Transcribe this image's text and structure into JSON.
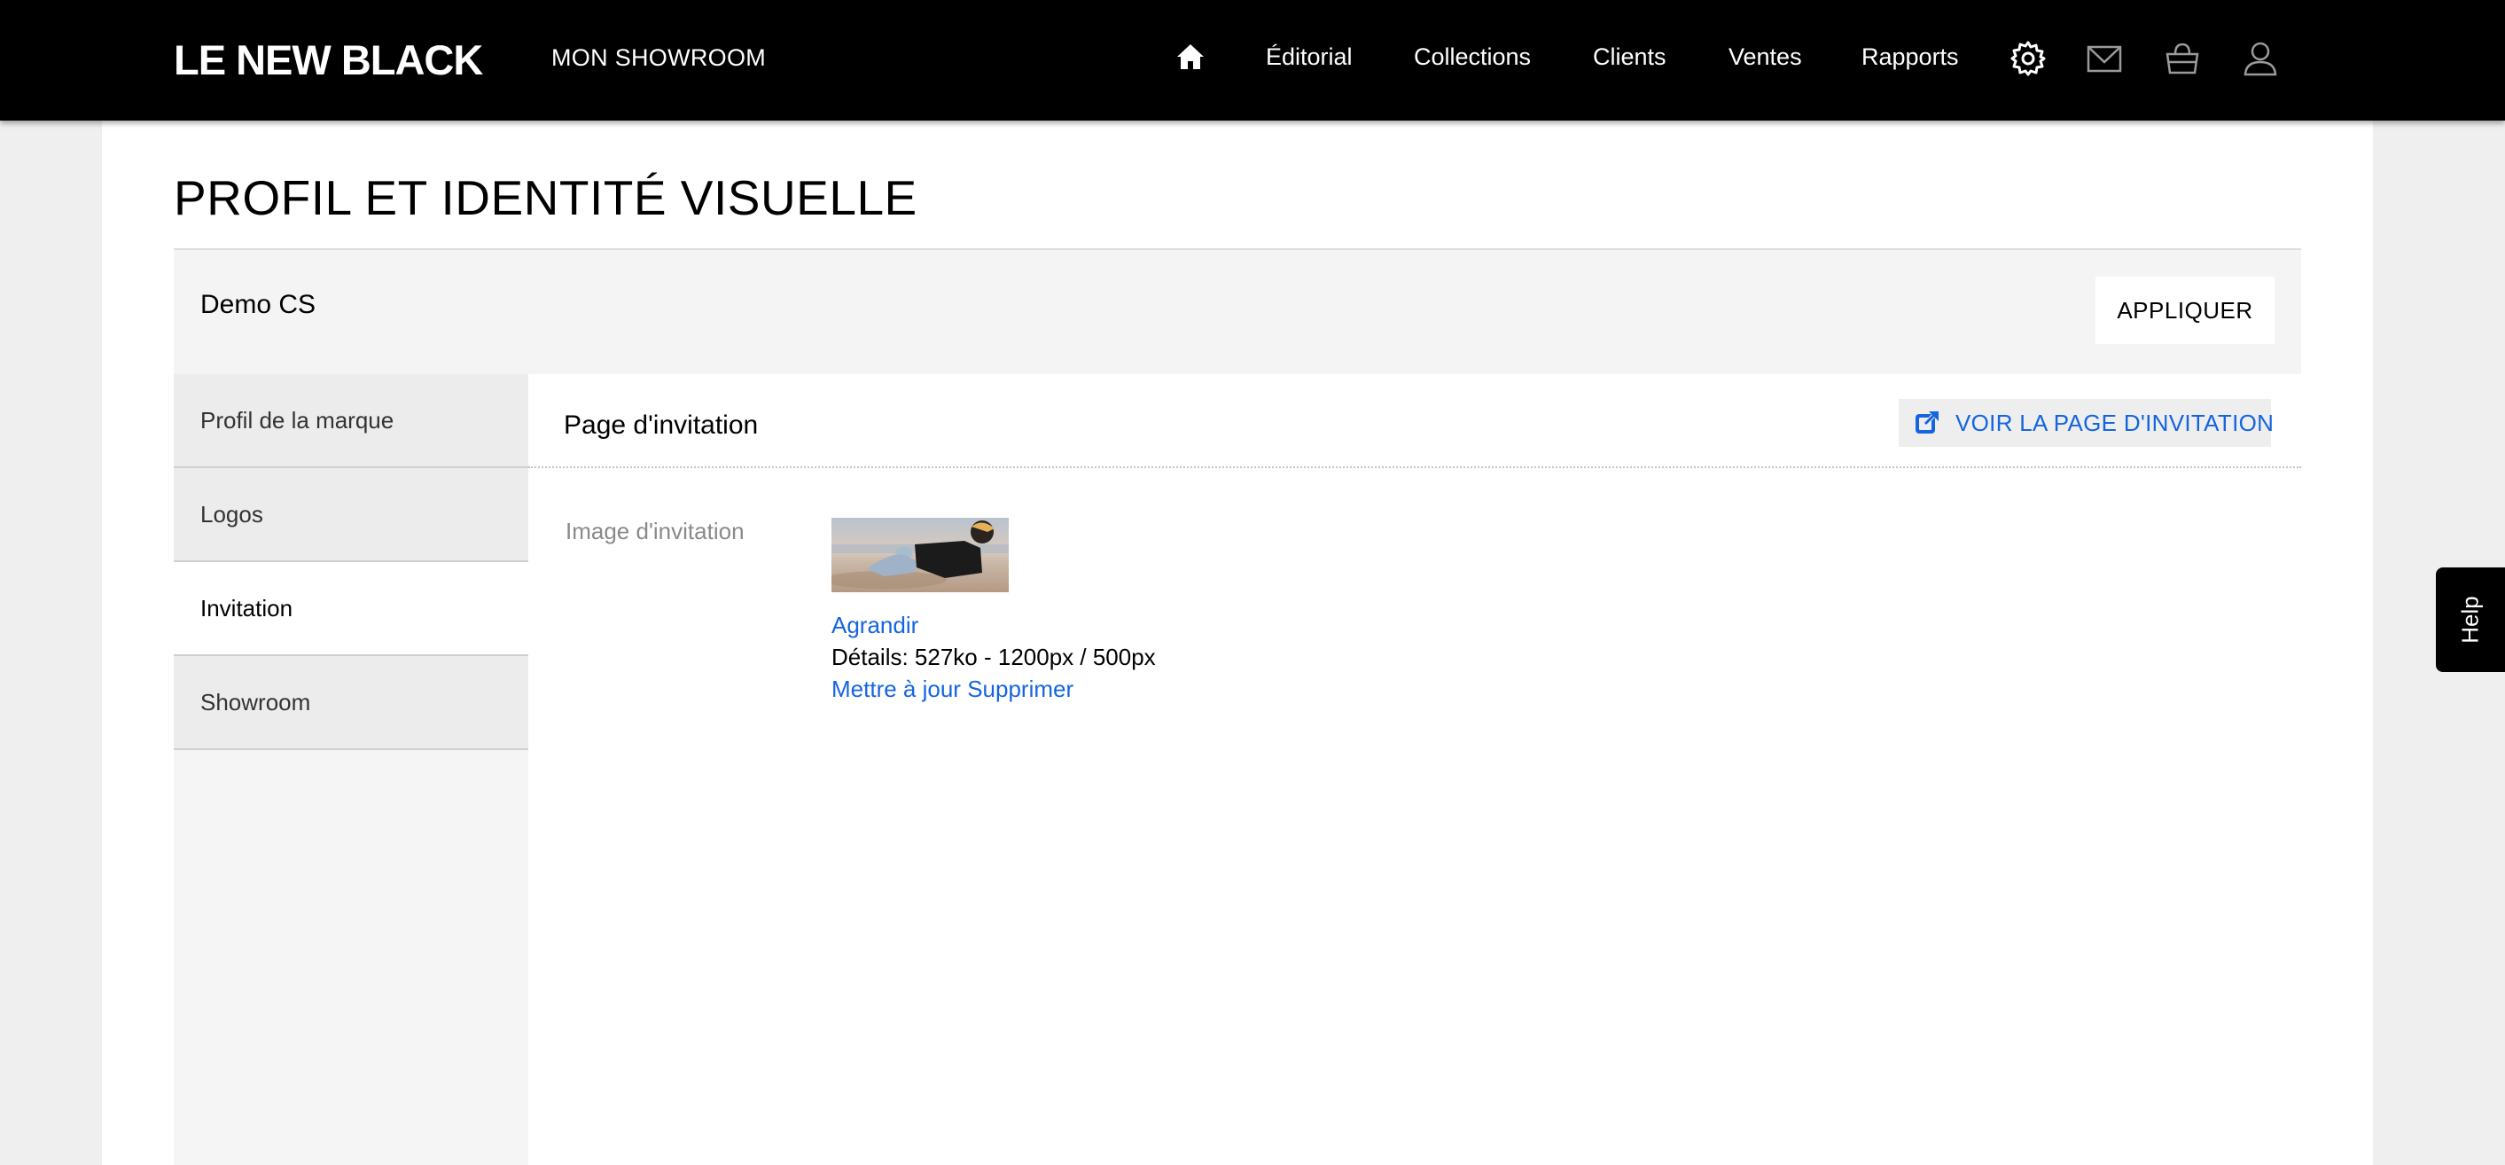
{
  "header": {
    "brand": "LE NEW BLACK",
    "app_title": "MON SHOWROOM",
    "nav": [
      "Éditorial",
      "Collections",
      "Clients",
      "Ventes",
      "Rapports"
    ],
    "icons": [
      "home-icon",
      "gear-icon",
      "mail-icon",
      "basket-icon",
      "user-icon"
    ]
  },
  "page": {
    "title": "PROFIL ET IDENTITÉ VISUELLE",
    "brand_name": "Demo CS",
    "apply_label": "APPLIQUER"
  },
  "sidebar": {
    "items": [
      {
        "label": "Profil de la marque",
        "active": false
      },
      {
        "label": "Logos",
        "active": false
      },
      {
        "label": "Invitation",
        "active": true
      },
      {
        "label": "Showroom",
        "active": false
      }
    ]
  },
  "panel": {
    "title": "Page d'invitation",
    "view_button": "VOIR LA PAGE D'INVITATION",
    "field_label": "Image d'invitation",
    "enlarge": "Agrandir",
    "details": "Détails: 527ko - 1200px / 500px",
    "update": "Mettre à jour",
    "delete": "Supprimer"
  },
  "help": "Help",
  "colors": {
    "link": "#1565e0",
    "topbar": "#000000"
  }
}
